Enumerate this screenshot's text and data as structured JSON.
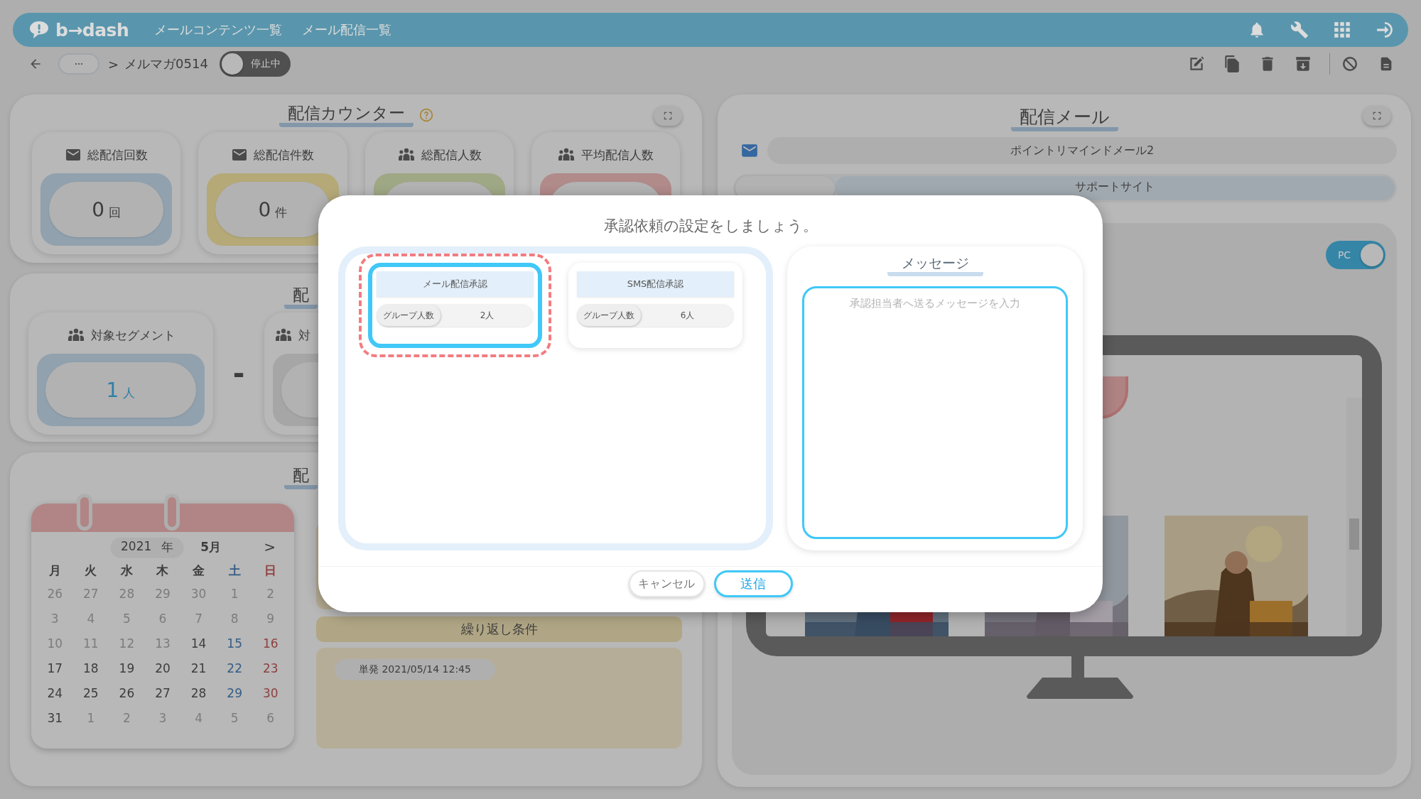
{
  "header": {
    "logo": "b→dash",
    "nav": [
      {
        "label": "メールコンテンツ一覧"
      },
      {
        "label": "メール配信一覧"
      }
    ]
  },
  "toolbar": {
    "separator": ">",
    "breadcrumb": "メルマガ0514",
    "status_toggle": {
      "label": "停止中",
      "on": false
    }
  },
  "counter": {
    "title": "配信カウンター",
    "cards": [
      {
        "kind": "mail",
        "label": "総配信回数",
        "value": "0",
        "unit": "回",
        "color": "#91a1ae"
      },
      {
        "kind": "mail",
        "label": "総配信件数",
        "value": "0",
        "unit": "件",
        "color": "#b5a978"
      },
      {
        "kind": "people",
        "label": "総配信人数",
        "color": "#9fa885"
      },
      {
        "kind": "people",
        "label": "平均配信人数",
        "color": "#b18a8a"
      }
    ]
  },
  "segments": {
    "title": "配",
    "operator": "-",
    "cards": [
      {
        "label": "対象セグメント",
        "value": "1",
        "unit": "人",
        "color": "#91a1ae"
      },
      {
        "label": "対",
        "color": "#a6a6a6"
      }
    ]
  },
  "schedule": {
    "title": "配",
    "calendar": {
      "year": "2021",
      "year_unit": "年",
      "month": "5月",
      "next": ">",
      "weekdays": [
        "月",
        "火",
        "水",
        "木",
        "金",
        "土",
        "日"
      ],
      "days": [
        {
          "label": "26",
          "disabled": true
        },
        {
          "label": "27",
          "disabled": true
        },
        {
          "label": "28",
          "disabled": true
        },
        {
          "label": "29",
          "disabled": true
        },
        {
          "label": "30",
          "disabled": true
        },
        {
          "label": "1",
          "disabled": true
        },
        {
          "label": "2",
          "disabled": true
        },
        {
          "label": "3",
          "disabled": true
        },
        {
          "label": "4",
          "disabled": true
        },
        {
          "label": "5",
          "disabled": true
        },
        {
          "label": "6",
          "disabled": true
        },
        {
          "label": "7",
          "disabled": true
        },
        {
          "label": "8",
          "disabled": true
        },
        {
          "label": "9",
          "disabled": true
        },
        {
          "label": "10",
          "disabled": true
        },
        {
          "label": "11",
          "disabled": true
        },
        {
          "label": "12",
          "disabled": true
        },
        {
          "label": "13",
          "disabled": true
        },
        {
          "label": "14",
          "disabled": false
        },
        {
          "label": "15",
          "disabled": false
        },
        {
          "label": "16",
          "disabled": false
        },
        {
          "label": "17",
          "disabled": false
        },
        {
          "label": "18",
          "disabled": false
        },
        {
          "label": "19",
          "disabled": false
        },
        {
          "label": "20",
          "disabled": false
        },
        {
          "label": "21",
          "disabled": false
        },
        {
          "label": "22",
          "disabled": false
        },
        {
          "label": "23",
          "disabled": false
        },
        {
          "label": "24",
          "disabled": false
        },
        {
          "label": "25",
          "disabled": false
        },
        {
          "label": "26",
          "disabled": false
        },
        {
          "label": "27",
          "disabled": false
        },
        {
          "label": "28",
          "disabled": false
        },
        {
          "label": "29",
          "disabled": false
        },
        {
          "label": "30",
          "disabled": false
        },
        {
          "label": "31",
          "disabled": false
        },
        {
          "label": "1",
          "disabled": true
        },
        {
          "label": "2",
          "disabled": true
        },
        {
          "label": "3",
          "disabled": true
        },
        {
          "label": "4",
          "disabled": true
        },
        {
          "label": "5",
          "disabled": true
        },
        {
          "label": "6",
          "disabled": true
        }
      ]
    },
    "repeat": {
      "title": "繰り返し条件",
      "items": [
        "単発 2021/05/14 12:45"
      ]
    }
  },
  "mail": {
    "title": "配信メール",
    "subject": "ポイントリマインドメール2",
    "sender": "サポートサイト",
    "device_toggle": {
      "label": "PC",
      "on": true
    }
  },
  "modal": {
    "title": "承認依頼の設定をしましょう。",
    "approvals": [
      {
        "label": "メール配信承認",
        "group_label": "グループ人数",
        "count": "2人",
        "selected": true,
        "highlighted": true
      },
      {
        "label": "SMS配信承認",
        "group_label": "グループ人数",
        "count": "6人",
        "selected": false,
        "highlighted": false
      }
    ],
    "message": {
      "title": "メッセージ",
      "placeholder": "承認担当者へ送るメッセージを入力"
    },
    "buttons": [
      {
        "label": "キャンセル",
        "kind": "cancel"
      },
      {
        "label": "送信",
        "kind": "primary"
      }
    ]
  }
}
